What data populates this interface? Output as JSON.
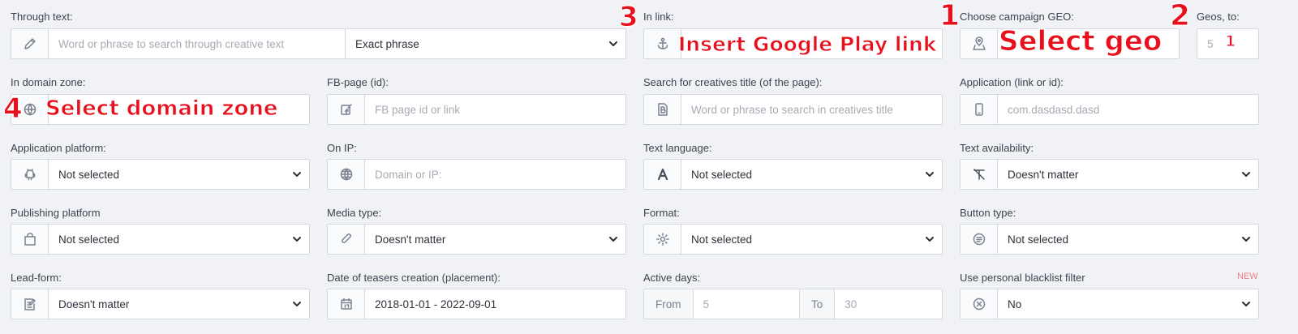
{
  "fields": {
    "through_text": {
      "label": "Through text:",
      "placeholder": "Word or phrase to search through creative text",
      "mode": "Exact phrase",
      "icon": "pencil-icon"
    },
    "in_link": {
      "label": "In link:",
      "placeholder": "Insert Google Play link",
      "icon": "anchor-icon"
    },
    "campaign_geo": {
      "label": "Choose campaign GEO:",
      "placeholder": "Select geo",
      "icon": "map-pin-icon"
    },
    "geos_to": {
      "label": "Geos, to:",
      "placeholder": "5"
    },
    "domain_zone": {
      "label": "In domain zone:",
      "placeholder": "Select domain zone",
      "icon": "globe-icon"
    },
    "fb_page": {
      "label": "FB-page (id):",
      "placeholder": "FB page id or link",
      "icon": "facebook-page-icon"
    },
    "creatives_title": {
      "label": "Search for creatives title (of the page):",
      "placeholder": "Word or phrase to search in creatives title",
      "icon": "text-b-icon"
    },
    "application": {
      "label": "Application (link or id):",
      "placeholder": "com.dasdasd.dasd",
      "icon": "phone-icon"
    },
    "app_platform": {
      "label": "Application platform:",
      "value": "Not selected",
      "icon": "android-icon"
    },
    "on_ip": {
      "label": "On IP:",
      "placeholder": "Domain or IP:",
      "icon": "network-globe-icon"
    },
    "text_language": {
      "label": "Text language:",
      "value": "Not selected",
      "icon": "letter-a-icon"
    },
    "text_availability": {
      "label": "Text availability:",
      "value": "Doesn't matter",
      "icon": "text-off-icon"
    },
    "publishing_platform": {
      "label": "Publishing platform",
      "value": "Not selected",
      "icon": "shopping-bag-icon"
    },
    "media_type": {
      "label": "Media type:",
      "value": "Doesn't matter",
      "icon": "paperclip-icon"
    },
    "format": {
      "label": "Format:",
      "value": "Not selected",
      "icon": "gear-icon"
    },
    "button_type": {
      "label": "Button type:",
      "value": "Not selected",
      "icon": "list-circle-icon"
    },
    "lead_form": {
      "label": "Lead-form:",
      "value": "Doesn't matter",
      "icon": "form-edit-icon"
    },
    "date_creation": {
      "label": "Date of teasers creation (placement):",
      "value": "2018-01-01 - 2022-09-01",
      "icon": "calendar-icon"
    },
    "active_days": {
      "label": "Active days:",
      "from_label": "From",
      "from_placeholder": "5",
      "to_label": "To",
      "to_placeholder": "30"
    },
    "blacklist": {
      "label": "Use personal blacklist filter",
      "badge": "NEW",
      "value": "No",
      "icon": "circle-x-icon"
    }
  },
  "annotations": {
    "n1": "1",
    "n2": "2",
    "n3": "3",
    "n4": "4",
    "insert_google_play": "Insert Google Play link",
    "select_geo": "Select geo",
    "select_domain_zone": "Select domain zone",
    "geos_value": "1"
  },
  "colors": {
    "annotation": "#e8101d",
    "badge": "#f07b7b",
    "background": "#f1f2f6"
  }
}
